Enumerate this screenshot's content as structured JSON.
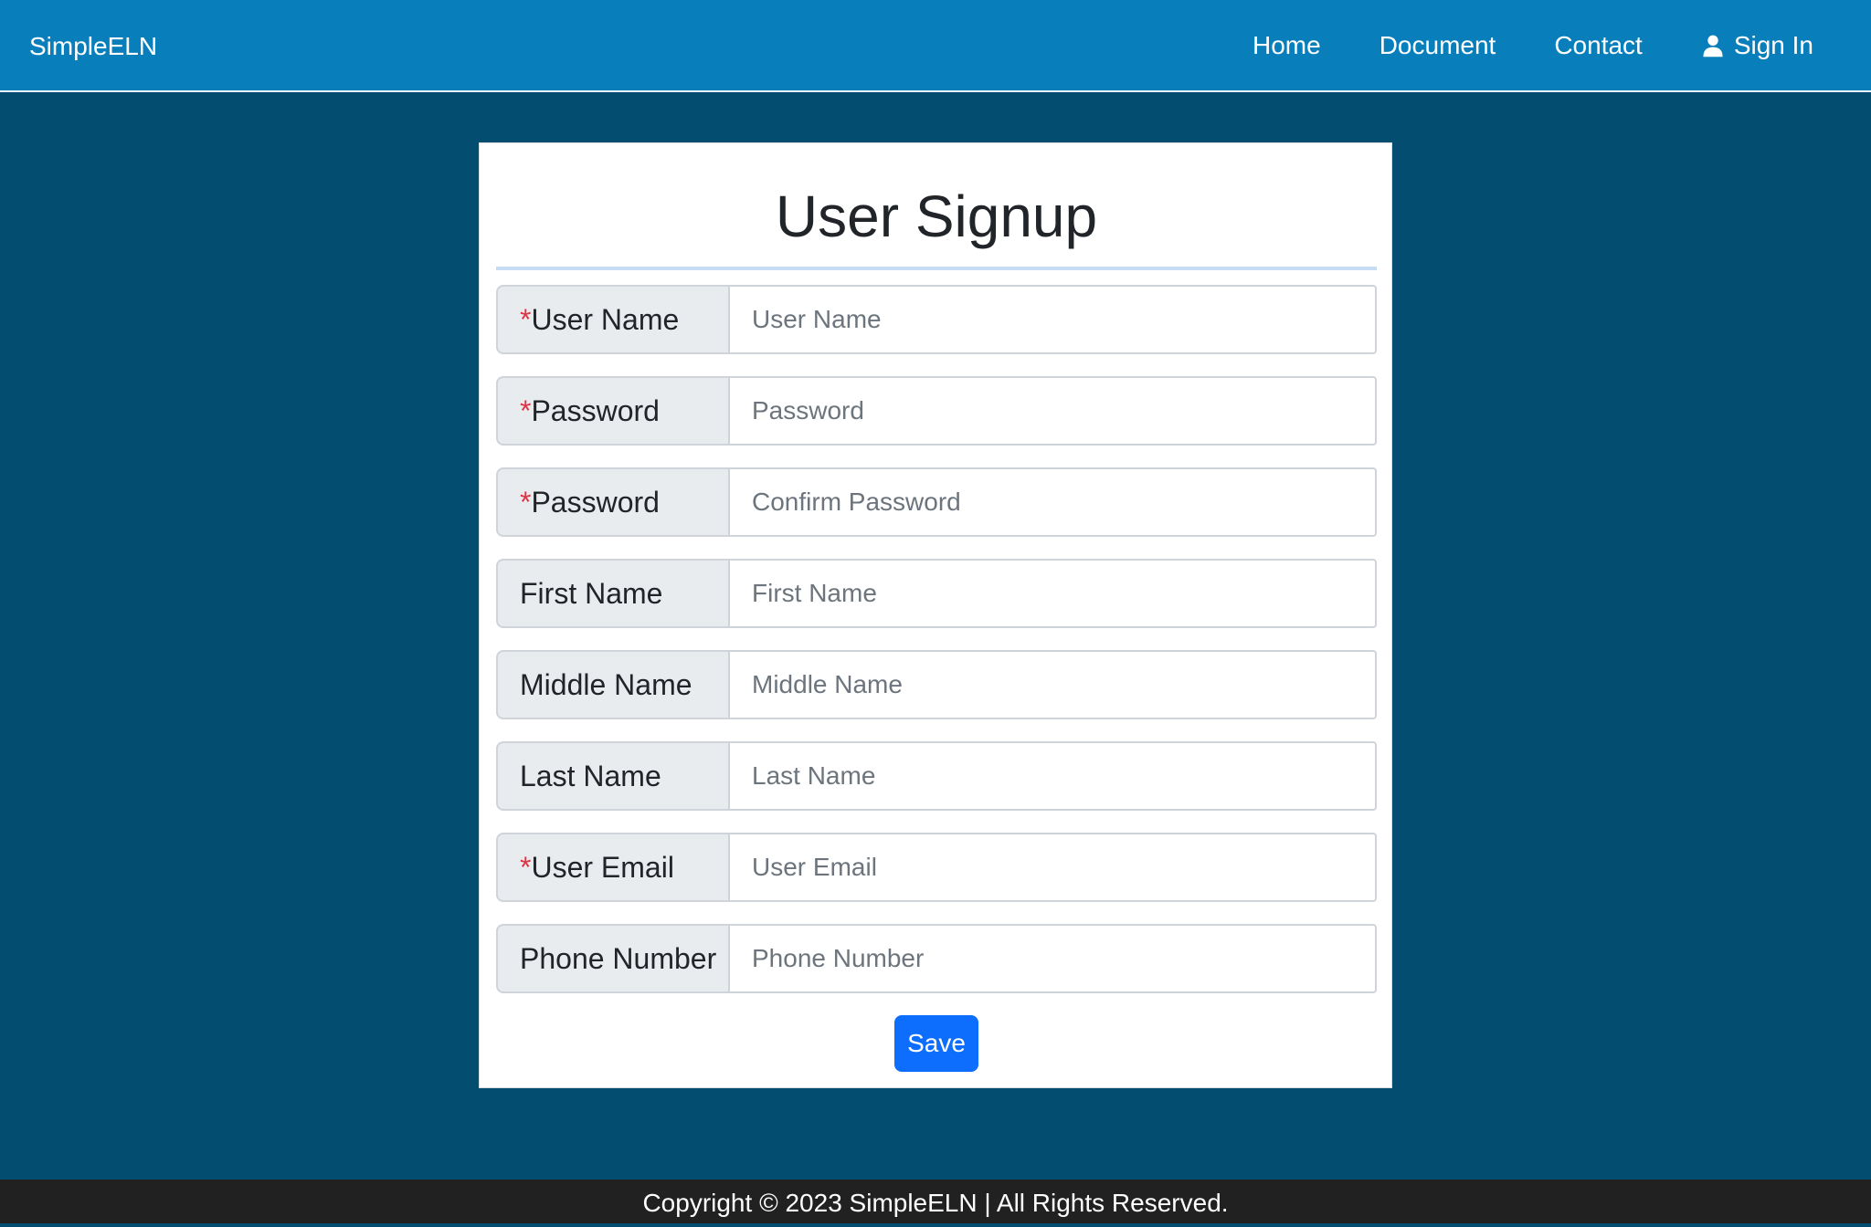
{
  "navbar": {
    "brand": "SimpleELN",
    "links": [
      {
        "label": "Home"
      },
      {
        "label": "Document"
      },
      {
        "label": "Contact"
      },
      {
        "label": "Sign In",
        "icon": "user-icon"
      }
    ]
  },
  "signup": {
    "title": "User Signup",
    "required_marker": "*",
    "fields": [
      {
        "label": "User Name",
        "required": true,
        "placeholder": "User Name",
        "value": ""
      },
      {
        "label": "Password",
        "required": true,
        "placeholder": "Password",
        "value": ""
      },
      {
        "label": "Password",
        "required": true,
        "placeholder": "Confirm Password",
        "value": ""
      },
      {
        "label": "First Name",
        "required": false,
        "placeholder": "First Name",
        "value": ""
      },
      {
        "label": "Middle Name",
        "required": false,
        "placeholder": "Middle Name",
        "value": ""
      },
      {
        "label": "Last Name",
        "required": false,
        "placeholder": "Last Name",
        "value": ""
      },
      {
        "label": "User Email",
        "required": true,
        "placeholder": "User Email",
        "value": ""
      },
      {
        "label": "Phone Number",
        "required": false,
        "placeholder": "Phone Number",
        "value": ""
      }
    ],
    "save_label": "Save"
  },
  "footer": {
    "text": "Copyright © 2023 SimpleELN | All Rights Reserved."
  },
  "colors": {
    "page_background": "#024D70",
    "navbar_background": "#087EBB",
    "primary_button": "#0d6efd",
    "required_marker": "#dc3545",
    "footer_background": "#212121"
  }
}
